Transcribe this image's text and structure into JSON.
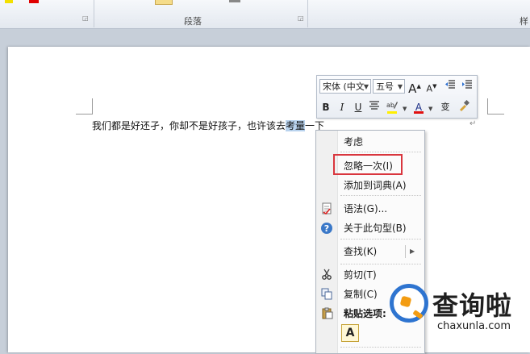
{
  "ribbon": {
    "paragraph_group_label": "段落",
    "right_group_label": "样"
  },
  "document": {
    "line_before": "我们都是好还孑，你却不是好孩子，也许该去",
    "selected_text": "考量",
    "line_after": "一下",
    "paragraph_mark": "↵"
  },
  "mini_toolbar": {
    "font_name": "宋体 (中文",
    "font_size": "五号",
    "grow_font": "A",
    "shrink_font": "A",
    "bold": "B",
    "italic": "I",
    "underline": "U",
    "font_color_letter": "A",
    "phonetic_letter": "变"
  },
  "context_menu": {
    "items": [
      {
        "label": "考虑"
      },
      {
        "label": "忽略一次(I)"
      },
      {
        "label": "添加到词典(A)"
      },
      {
        "label": "语法(G)..."
      },
      {
        "label": "关于此句型(B)"
      },
      {
        "label": "查找(K)"
      },
      {
        "label": "剪切(T)"
      },
      {
        "label": "复制(C)"
      },
      {
        "label": "粘贴选项:"
      }
    ],
    "paste_option_letter": "A"
  },
  "watermark": {
    "brand": "查询啦",
    "domain": "chaxunla.com"
  },
  "colors": {
    "highlight_border": "#d9363e",
    "selection": "#b9d3ee",
    "watermark_blue": "#2e74d0",
    "watermark_orange": "#f39c12"
  }
}
